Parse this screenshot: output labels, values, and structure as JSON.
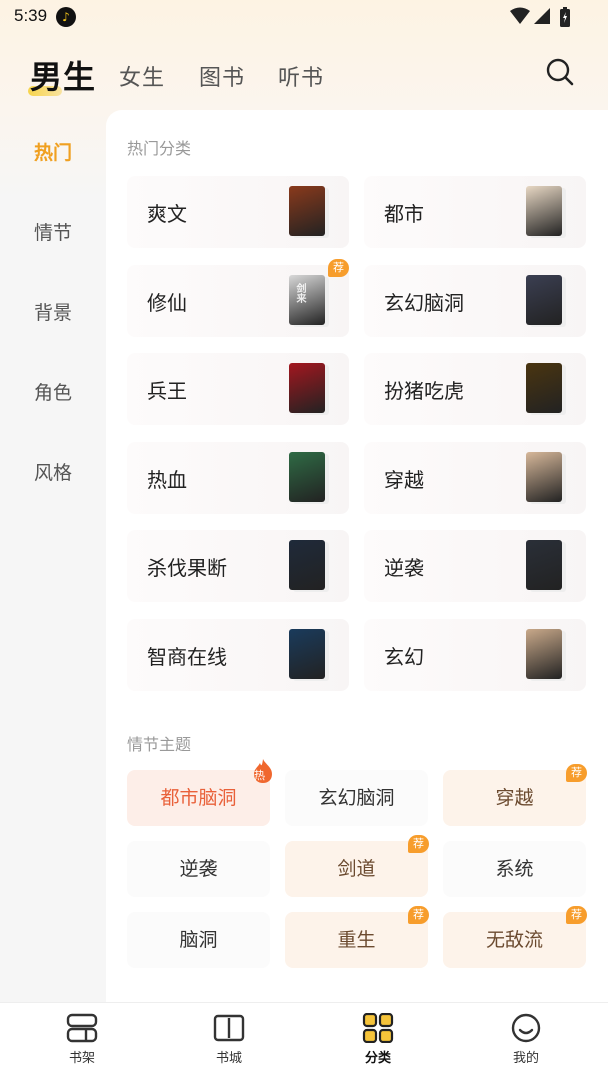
{
  "status": {
    "time": "5:39"
  },
  "top_tabs": [
    "男生",
    "女生",
    "图书",
    "听书"
  ],
  "sidebar": [
    "热门",
    "情节",
    "背景",
    "角色",
    "风格"
  ],
  "hot_section": {
    "title": "热门分类",
    "items": [
      {
        "label": "爽文",
        "cover_color": "#8a3a1c",
        "cover_text": ""
      },
      {
        "label": "都市",
        "cover_color": "#e8d8c4",
        "cover_text": ""
      },
      {
        "label": "修仙",
        "cover_color": "#d9d9d9",
        "cover_text": "剑来",
        "badge": "荐"
      },
      {
        "label": "玄幻脑洞",
        "cover_color": "#3b3f52",
        "cover_text": ""
      },
      {
        "label": "兵王",
        "cover_color": "#a3171f",
        "cover_text": ""
      },
      {
        "label": "扮猪吃虎",
        "cover_color": "#4a3510",
        "cover_text": ""
      },
      {
        "label": "热血",
        "cover_color": "#2f6b45",
        "cover_text": ""
      },
      {
        "label": "穿越",
        "cover_color": "#d7b89a",
        "cover_text": ""
      },
      {
        "label": "杀伐果断",
        "cover_color": "#1f2a3a",
        "cover_text": ""
      },
      {
        "label": "逆袭",
        "cover_color": "#2a2f38",
        "cover_text": ""
      },
      {
        "label": "智商在线",
        "cover_color": "#1a3b5c",
        "cover_text": ""
      },
      {
        "label": "玄幻",
        "cover_color": "#c9a98a",
        "cover_text": ""
      }
    ]
  },
  "plot_section": {
    "title": "情节主题",
    "tags": [
      {
        "label": "都市脑洞",
        "style": "hot",
        "badge": "热"
      },
      {
        "label": "玄幻脑洞",
        "style": "plain"
      },
      {
        "label": "穿越",
        "style": "rec",
        "badge": "荐"
      },
      {
        "label": "逆袭",
        "style": "plain"
      },
      {
        "label": "剑道",
        "style": "rec",
        "badge": "荐"
      },
      {
        "label": "系统",
        "style": "plain"
      },
      {
        "label": "脑洞",
        "style": "plain"
      },
      {
        "label": "重生",
        "style": "rec",
        "badge": "荐"
      },
      {
        "label": "无敌流",
        "style": "rec",
        "badge": "荐"
      }
    ]
  },
  "bottom_nav": [
    {
      "label": "书架",
      "icon": "bookshelf-icon"
    },
    {
      "label": "书城",
      "icon": "book-open-icon"
    },
    {
      "label": "分类",
      "icon": "category-grid-icon",
      "active": true
    },
    {
      "label": "我的",
      "icon": "profile-smile-icon"
    }
  ],
  "colors": {
    "accent": "#f0a020",
    "hot": "#e9613a",
    "badge": "#f79d2c"
  }
}
